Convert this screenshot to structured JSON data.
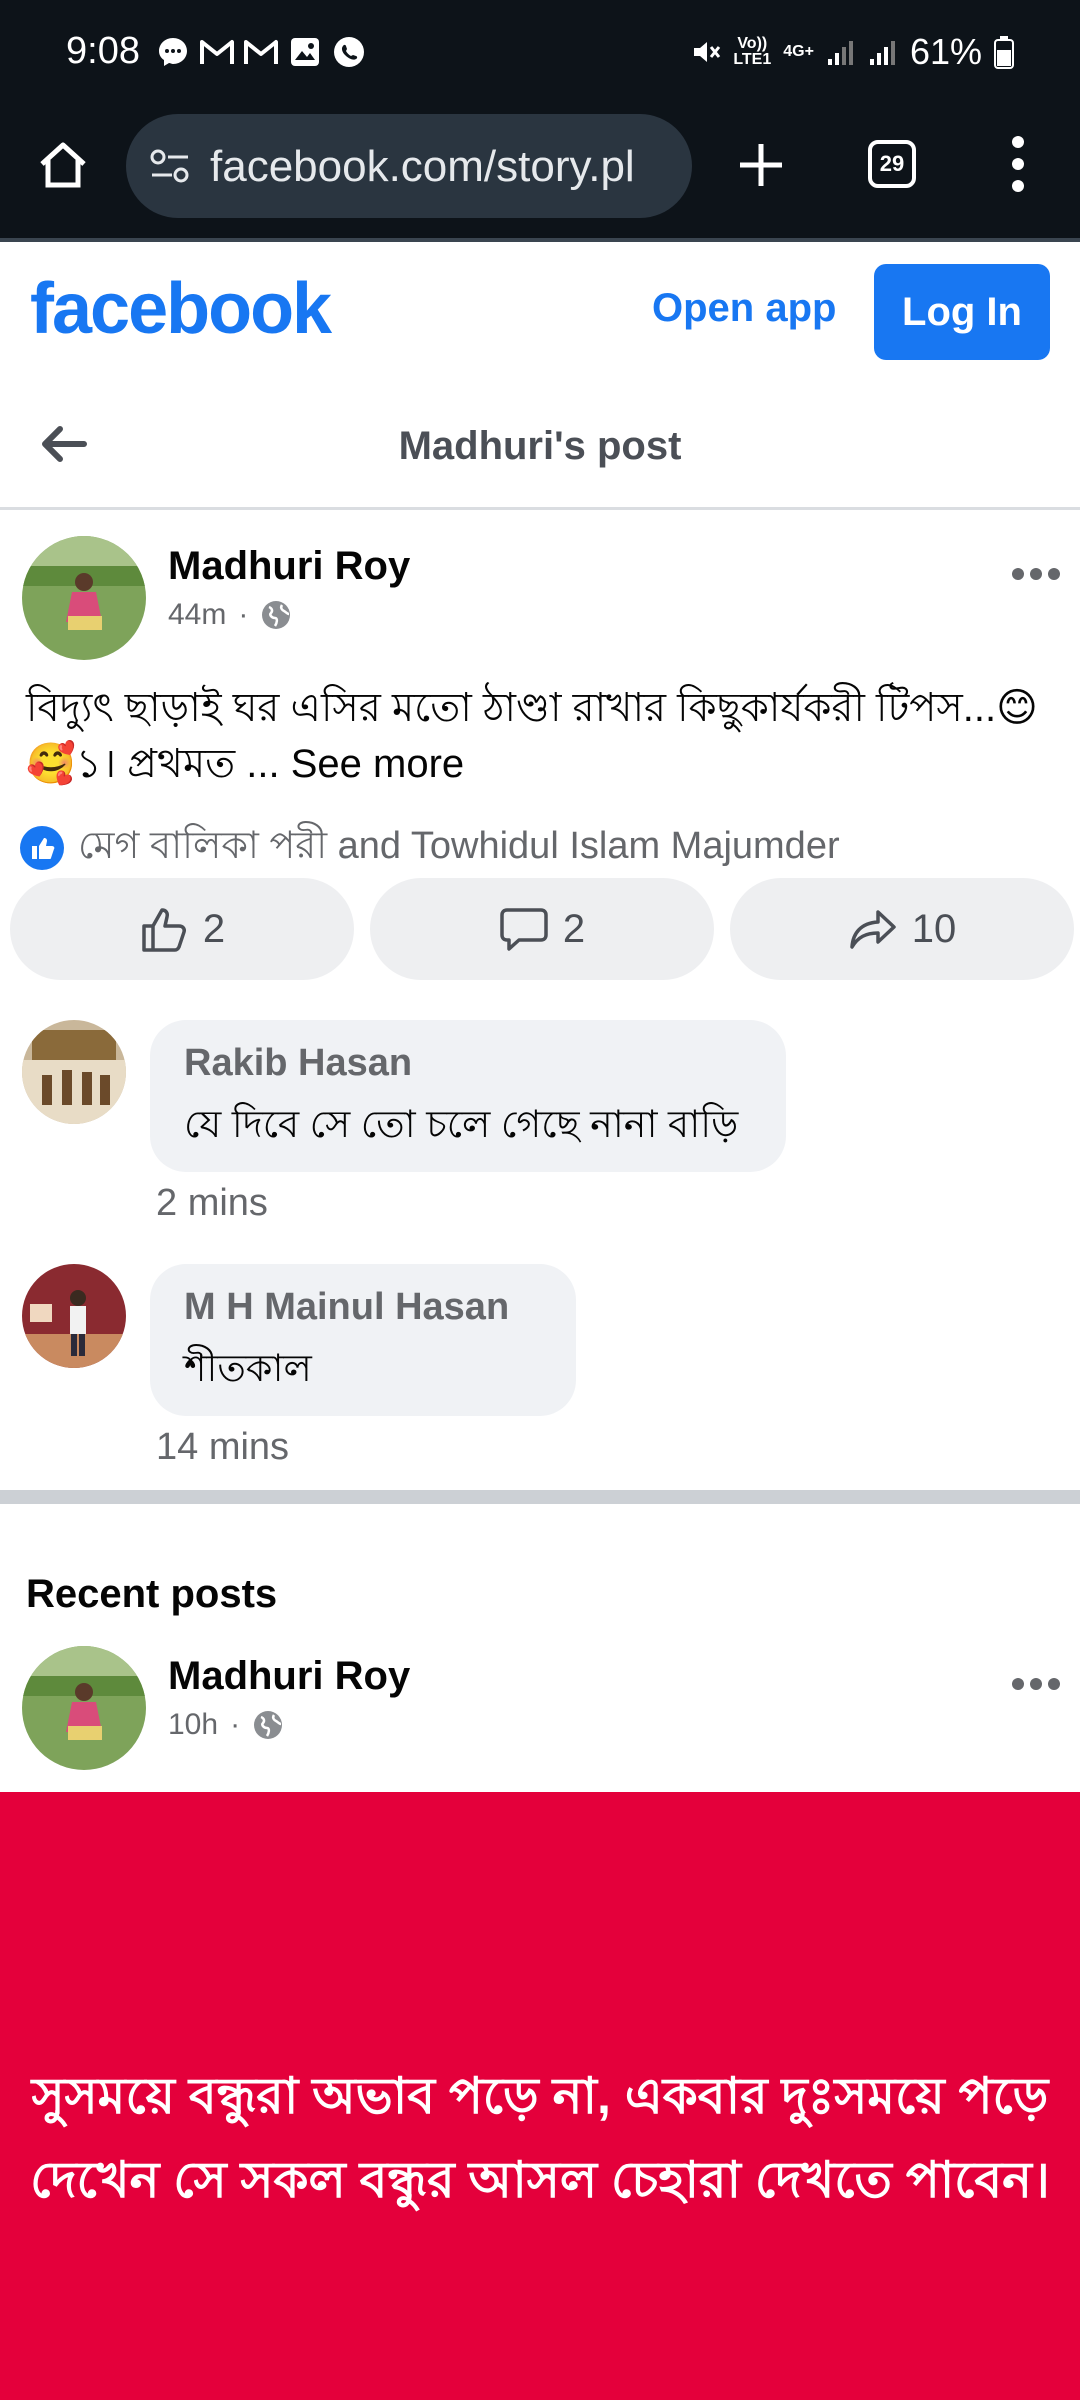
{
  "status_bar": {
    "time": "9:08",
    "network_top": "Vo))",
    "network_bottom": "LTE1",
    "net_type": "4G+",
    "battery": "61%"
  },
  "browser": {
    "url": "facebook.com/story.pl",
    "tab_count": "29"
  },
  "fb_header": {
    "logo": "facebook",
    "open_app": "Open app",
    "login": "Log In"
  },
  "page": {
    "title": "Madhuri's post"
  },
  "post": {
    "author": "Madhuri Roy",
    "time": "44m",
    "dot": "·",
    "text": "বিদ্যুৎ ছাড়াই ঘর এসির মতো ঠাণ্ডা রাখার কিছুকার্যকরী টিপস...😊🥰১। প্রথমত ...",
    "see_more": "See more",
    "reactions_text": "মেগ বালিকা পরী and Towhidul Islam Majumder",
    "likes": "2",
    "comments": "2",
    "shares": "10"
  },
  "comments": [
    {
      "name": "Rakib Hasan",
      "text": "যে দিবে সে তো চলে গেছে নানা বাড়ি",
      "time": "2 mins"
    },
    {
      "name": "M H Mainul Hasan",
      "text": "শীতকাল",
      "time": "14 mins"
    }
  ],
  "recent": {
    "title": "Recent posts",
    "author": "Madhuri Roy",
    "time": "10h",
    "dot": "·",
    "banner_text": "সুসময়ে বন্ধুরা অভাব পড়ে না, একবার দুঃসময়ে পড়ে দেখেন সে সকল বন্ধুর আসল চেহারা দেখতে পাবেন।"
  },
  "colors": {
    "brand": "#1877f2",
    "banner": "#e4003b"
  }
}
